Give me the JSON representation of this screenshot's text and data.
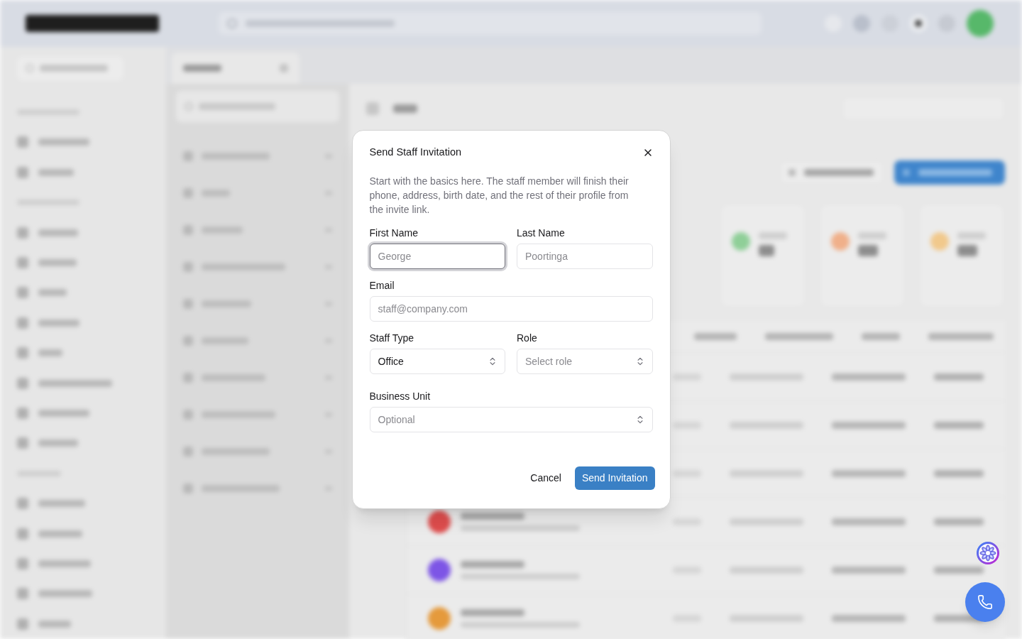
{
  "dialog": {
    "title": "Send Staff Invitation",
    "description": "Start with the basics here. The staff member will finish their phone, address, birth date, and the rest of their profile from the invite link.",
    "rows": [
      {
        "fields": [
          {
            "kind": "text",
            "label": "First Name",
            "placeholder": "George",
            "focused": true
          },
          {
            "kind": "text",
            "label": "Last Name",
            "placeholder": "Poortinga",
            "focused": false
          }
        ]
      },
      {
        "fields": [
          {
            "kind": "text",
            "label": "Email",
            "placeholder": "staff@company.com",
            "focused": false
          }
        ]
      },
      {
        "fields": [
          {
            "kind": "select",
            "label": "Staff Type",
            "value": "Office",
            "focused": false
          },
          {
            "kind": "select",
            "label": "Role",
            "placeholder": "Select role",
            "focused": false
          }
        ]
      },
      {
        "fields": [
          {
            "kind": "select",
            "label": "Business Unit",
            "placeholder": "Optional",
            "focused": false
          }
        ]
      }
    ],
    "buttons": [
      {
        "kind": "secondary",
        "label": "Cancel"
      },
      {
        "kind": "primary",
        "label": "Send Invitation"
      }
    ]
  }
}
